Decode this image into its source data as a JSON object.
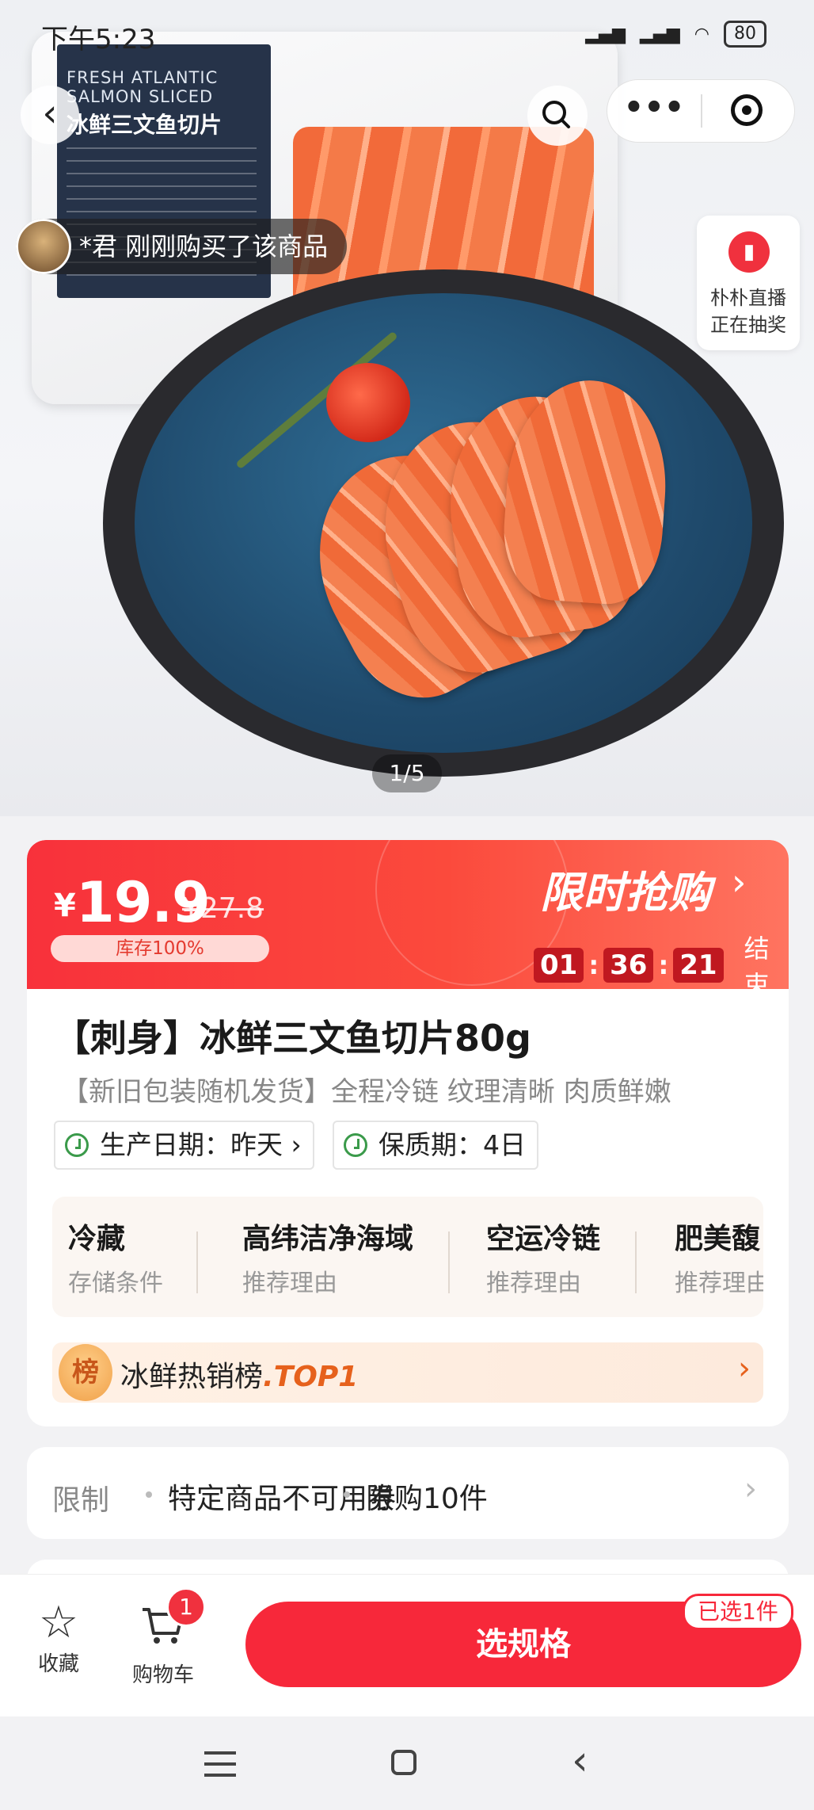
{
  "status_bar": {
    "time": "下午5:23",
    "network": "HD",
    "battery": "80"
  },
  "hero": {
    "package_label_en": "FRESH ATLANTIC SALMON SLICED",
    "package_label_cn": "冰鲜三文鱼切片",
    "pager": "1/5"
  },
  "nav": {
    "back_icon": "‹",
    "more_icon": "•••"
  },
  "buyer_notice": "*君 刚刚购买了该商品",
  "live": {
    "line1": "朴朴直播",
    "line2": "正在抽奖"
  },
  "price": {
    "currency": "¥",
    "current": "19.9",
    "original": "¥27.8",
    "stock": "库存100%",
    "flash_title": "限时抢购",
    "arrow": "›",
    "timer": {
      "h": "01",
      "m": "36",
      "s": "21"
    },
    "timer_end": "结束",
    "colors": {
      "banner": "#f8313b",
      "accent": "#ff7460"
    }
  },
  "product": {
    "title": "【刺身】冰鲜三文鱼切片80g",
    "subtitle": "【新旧包装随机发货】全程冷链 纹理清晰 肉质鲜嫩",
    "production_date": "生产日期：昨天",
    "shelf_life": "保质期：4日"
  },
  "features": [
    {
      "title": "冷藏",
      "sub": "存储条件"
    },
    {
      "title": "高纬洁净海域",
      "sub": "推荐理由"
    },
    {
      "title": "空运冷链",
      "sub": "推荐理由"
    },
    {
      "title": "肥美馥",
      "sub": "推荐理由"
    }
  ],
  "rank": {
    "icon": "榜",
    "text": "冰鲜热销榜",
    "top": ".TOP1",
    "arrow": "›"
  },
  "limits": {
    "label": "限制",
    "items": [
      "特定商品不可用券",
      "限购10件"
    ],
    "arrow": "›"
  },
  "action_bar": {
    "favorite": "收藏",
    "cart": "购物车",
    "cart_count": "1",
    "select_spec": "选规格",
    "selected": "已选1件",
    "favorite_icon": "star-icon",
    "cart_icon": "cart-icon"
  }
}
